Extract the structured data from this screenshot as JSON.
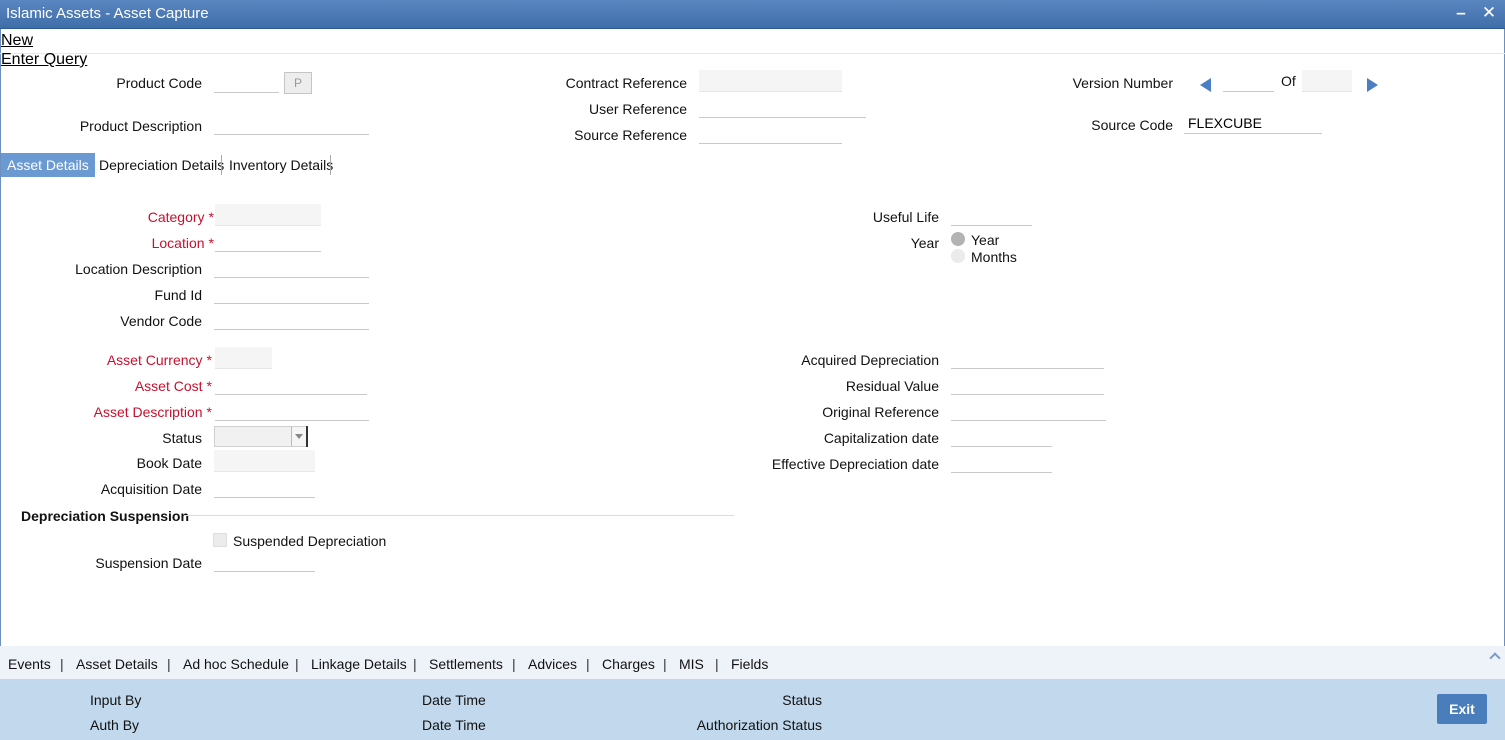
{
  "window": {
    "title": "Islamic Assets - Asset Capture",
    "minimize_icon": "minimize-icon",
    "close_icon": "close-icon"
  },
  "toolbar": {
    "new_label": "New",
    "enter_query_label": "Enter Query"
  },
  "header": {
    "product_code_label": "Product Code",
    "product_code_value": "",
    "pick_button_label": "P",
    "product_description_label": "Product Description",
    "product_description_value": "",
    "contract_reference_label": "Contract Reference",
    "contract_reference_value": "",
    "user_reference_label": "User Reference",
    "user_reference_value": "",
    "source_reference_label": "Source Reference",
    "source_reference_value": "",
    "version_number_label": "Version Number",
    "version_number_value": "",
    "of_label": "Of",
    "of_value": "",
    "source_code_label": "Source Code",
    "source_code_value": "FLEXCUBE"
  },
  "tabs": [
    "Asset Details",
    "Depreciation Details",
    "Inventory Details"
  ],
  "asset": {
    "category_label": "Category",
    "location_label": "Location",
    "location_description_label": "Location Description",
    "fund_id_label": "Fund Id",
    "vendor_code_label": "Vendor Code",
    "asset_currency_label": "Asset Currency",
    "asset_cost_label": "Asset Cost",
    "asset_description_label": "Asset Description",
    "status_label": "Status",
    "status_value": "",
    "book_date_label": "Book Date",
    "acquisition_date_label": "Acquisition Date",
    "required_mark": "*",
    "useful_life_label": "Useful Life",
    "year_label": "Year",
    "radio_year_label": "Year",
    "radio_months_label": "Months",
    "acquired_depreciation_label": "Acquired Depreciation",
    "residual_value_label": "Residual Value",
    "original_reference_label": "Original Reference",
    "capitalization_date_label": "Capitalization date",
    "effective_depreciation_date_label": "Effective Depreciation date"
  },
  "suspension": {
    "section_title": "Depreciation Suspension",
    "suspended_depreciation_label": "Suspended Depreciation",
    "suspension_date_label": "Suspension Date"
  },
  "bottom_links": [
    "Events",
    "Asset Details",
    "Ad hoc Schedule",
    "Linkage Details",
    "Settlements",
    "Advices",
    "Charges",
    "MIS",
    "Fields"
  ],
  "footer": {
    "input_by_label": "Input By",
    "auth_by_label": "Auth By",
    "date_time_label": "Date Time",
    "status_label": "Status",
    "authorization_status_label": "Authorization Status",
    "exit_label": "Exit"
  },
  "colors": {
    "title_bar": "#4a78b4",
    "required": "#c8102e",
    "active_tab": "#6b9ad2",
    "footer": "#c1d8ed",
    "exit_button": "#4a7dbb"
  }
}
